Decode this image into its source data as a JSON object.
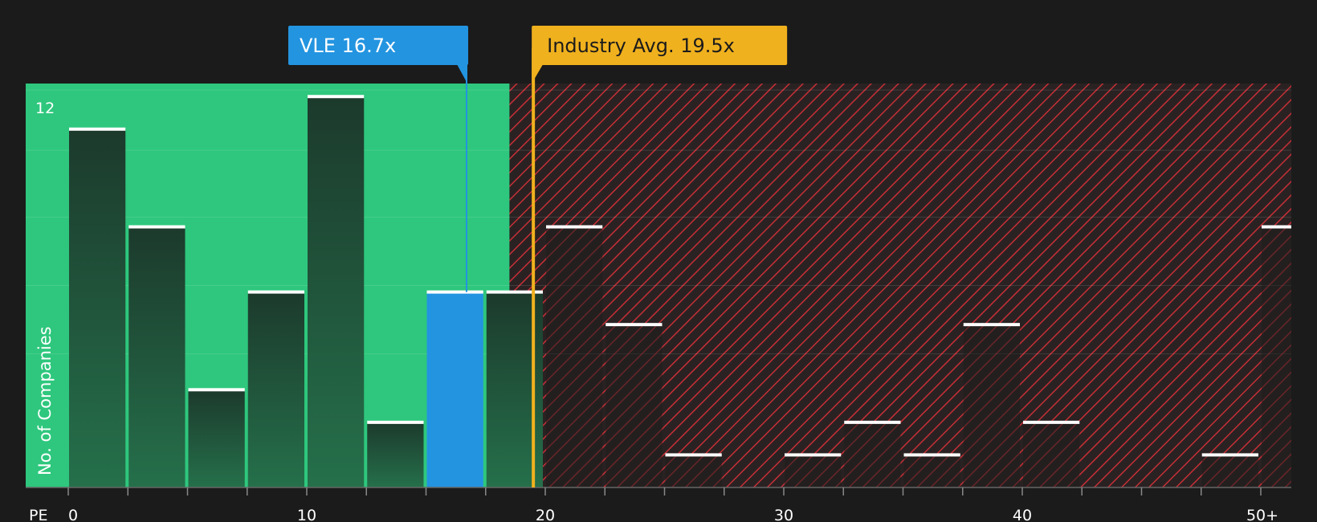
{
  "chart_data": {
    "type": "bar",
    "xlabel": "PE",
    "ylabel": "No. of Companies",
    "x_ticks": [
      "0",
      "10",
      "20",
      "30",
      "40",
      "50+"
    ],
    "y_tick_labels": [
      "12"
    ],
    "ylim": [
      0,
      12.4
    ],
    "bin_width": 2.5,
    "bins": [
      {
        "x0": 0,
        "value": 11
      },
      {
        "x0": 2.5,
        "value": 8
      },
      {
        "x0": 5,
        "value": 3
      },
      {
        "x0": 7.5,
        "value": 6
      },
      {
        "x0": 10,
        "value": 12
      },
      {
        "x0": 12.5,
        "value": 2
      },
      {
        "x0": 15,
        "value": 6,
        "highlight": true
      },
      {
        "x0": 17.5,
        "value": 6
      },
      {
        "x0": 20,
        "value": 8
      },
      {
        "x0": 22.5,
        "value": 5
      },
      {
        "x0": 25,
        "value": 1
      },
      {
        "x0": 27.5,
        "value": 0
      },
      {
        "x0": 30,
        "value": 1
      },
      {
        "x0": 32.5,
        "value": 2
      },
      {
        "x0": 35,
        "value": 1
      },
      {
        "x0": 37.5,
        "value": 5
      },
      {
        "x0": 40,
        "value": 2
      },
      {
        "x0": 42.5,
        "value": 0
      },
      {
        "x0": 45,
        "value": 0
      },
      {
        "x0": 47.5,
        "value": 1
      },
      {
        "x0": 50,
        "value": 8
      }
    ],
    "company": {
      "label": "VLE 16.7x",
      "value": 16.7,
      "color": "#2394e0"
    },
    "industry": {
      "label": "Industry Avg. 19.5x",
      "value": 19.5,
      "color": "#f0b11e"
    },
    "colors": {
      "background": "#1b1b1b",
      "undervalued_zone": "#2ec77d",
      "overvalued_zone": "#c62f37",
      "bar": "#1f3f32",
      "bar_highlight": "#2394e0",
      "bar_cap": "#ffffff",
      "text": "#ffffff",
      "gridline": "#ffffff"
    },
    "grid": true
  }
}
